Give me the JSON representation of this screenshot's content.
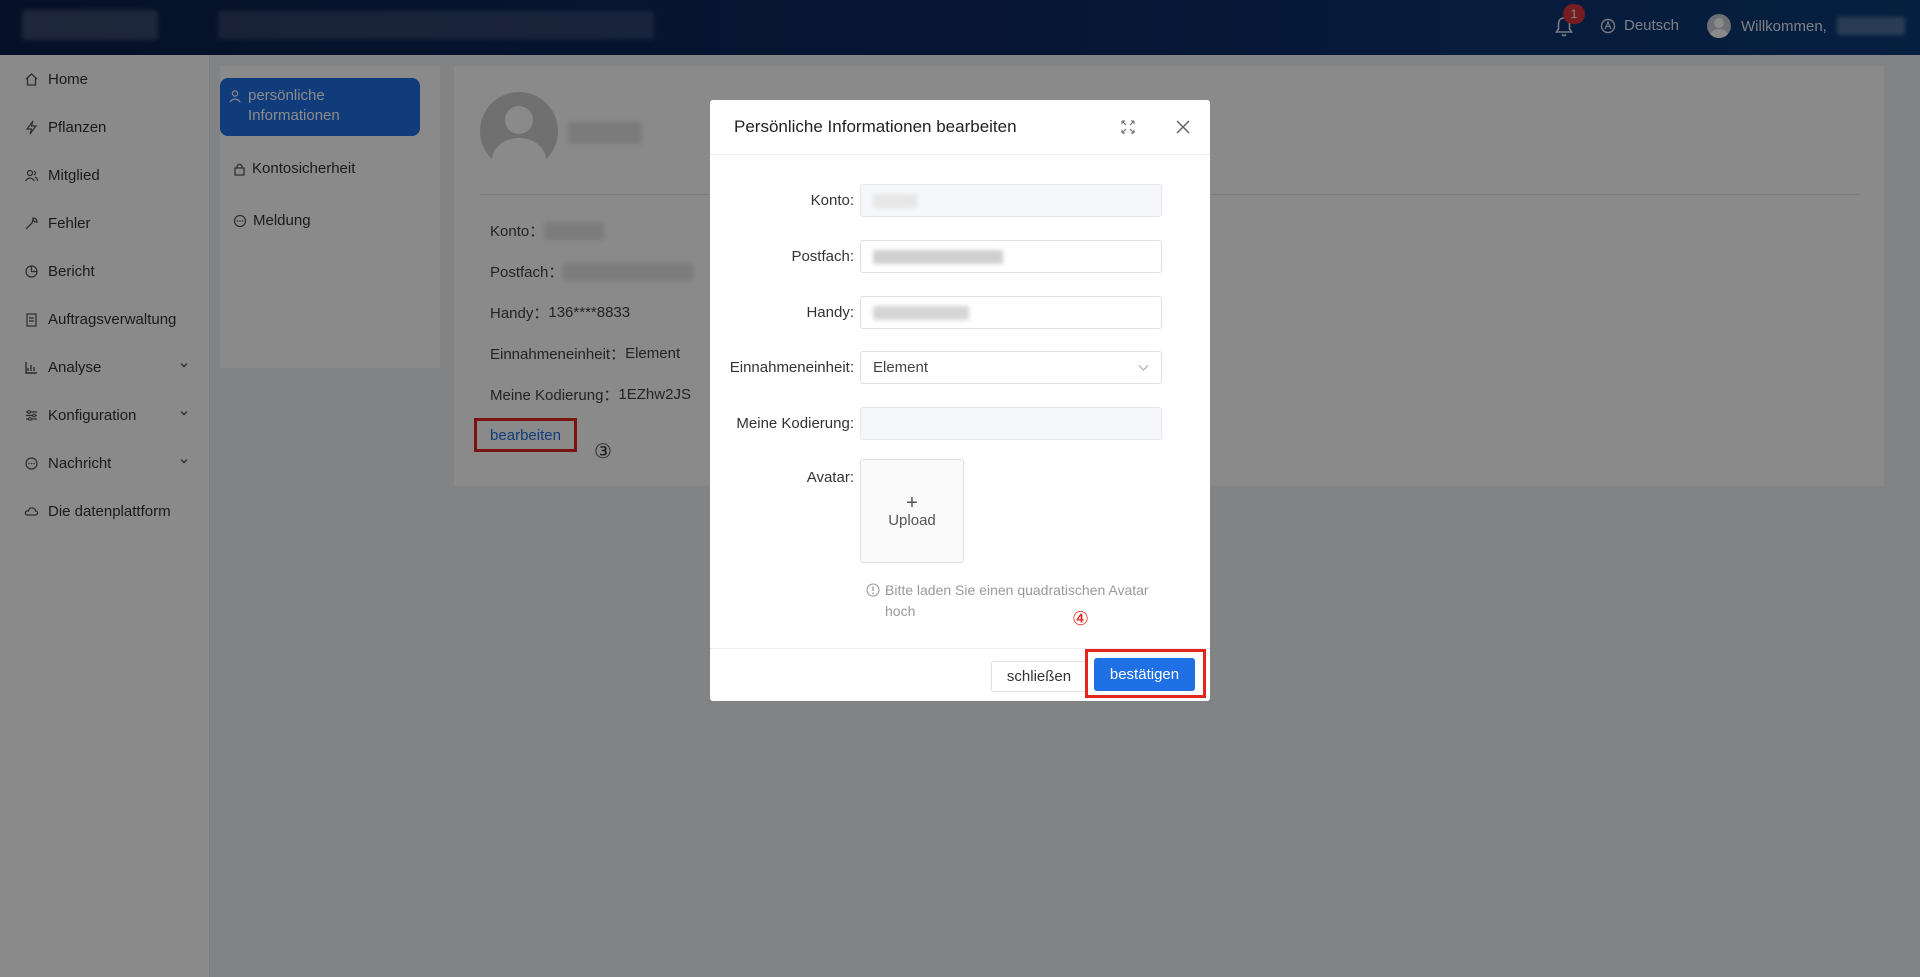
{
  "header": {
    "notification_count": "1",
    "language": "Deutsch",
    "welcome": "Willkommen,"
  },
  "sidebar": {
    "items": [
      {
        "label": "Home",
        "icon": "home-icon"
      },
      {
        "label": "Pflanzen",
        "icon": "bolt-icon"
      },
      {
        "label": "Mitglied",
        "icon": "users-icon"
      },
      {
        "label": "Fehler",
        "icon": "wrench-icon"
      },
      {
        "label": "Bericht",
        "icon": "pie-icon"
      },
      {
        "label": "Auftragsverwaltung",
        "icon": "clipboard-icon"
      },
      {
        "label": "Analyse",
        "icon": "chart-icon",
        "expandable": true
      },
      {
        "label": "Konfiguration",
        "icon": "sliders-icon",
        "expandable": true
      },
      {
        "label": "Nachricht",
        "icon": "chat-icon",
        "expandable": true
      },
      {
        "label": "Die datenplattform",
        "icon": "cloud-icon"
      }
    ]
  },
  "profile_tabs": {
    "personal": "persönliche Informationen",
    "security": "Kontosicherheit",
    "message": "Meldung"
  },
  "profile": {
    "konto_label": "Konto：",
    "postfach_label": "Postfach：",
    "handy_label": "Handy：",
    "handy_value": "136****8833",
    "unit_label": "Einnahmeneinheit：",
    "unit_value": "Element",
    "code_label": "Meine Kodierung：",
    "code_value": "1EZhw2JS",
    "edit_link": "bearbeiten",
    "step_marker": "③"
  },
  "modal": {
    "title": "Persönliche Informationen bearbeiten",
    "fields": {
      "konto": "Konto",
      "postfach": "Postfach",
      "handy": "Handy",
      "unit": "Einnahmeneinheit",
      "unit_value": "Element",
      "code": "Meine Kodierung",
      "avatar": "Avatar"
    },
    "upload_label": "Upload",
    "hint": "Bitte laden Sie einen quadratischen Avatar hoch",
    "close_button": "schließen",
    "confirm_button": "bestätigen",
    "step_marker": "④"
  },
  "colors": {
    "primary": "#1f6fe5",
    "highlight": "#e2261e",
    "badge": "#d9363e"
  }
}
